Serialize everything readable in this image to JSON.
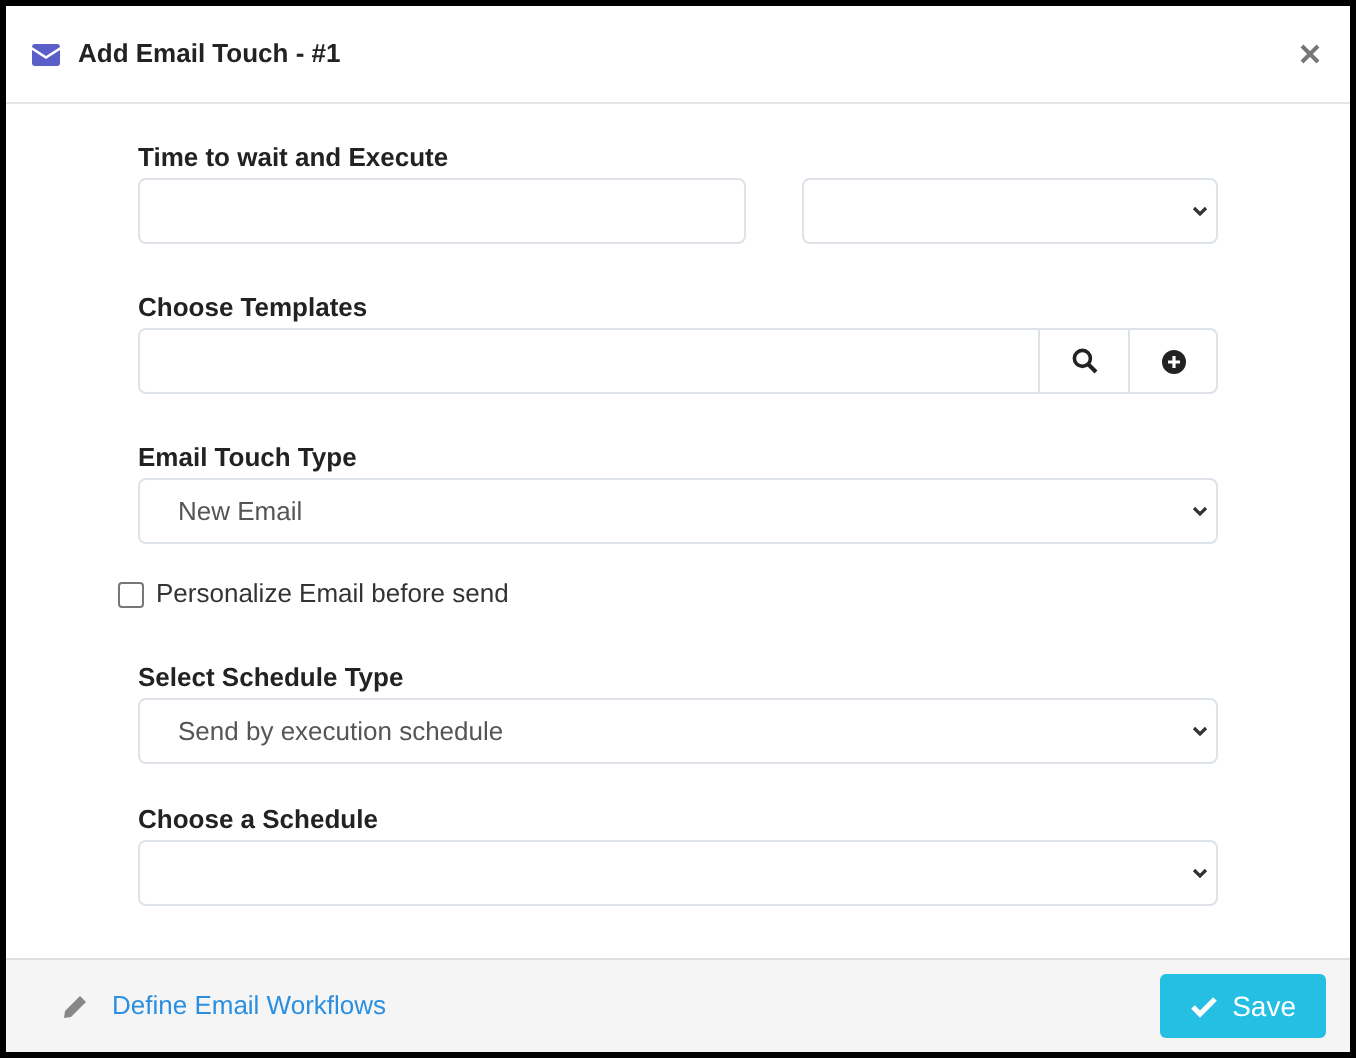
{
  "dialog": {
    "title": "Add Email Touch - #1"
  },
  "wait": {
    "label": "Time to wait and Execute"
  },
  "templates": {
    "label": "Choose Templates"
  },
  "touch_type": {
    "label": "Email Touch Type",
    "value": "New Email"
  },
  "personalize": {
    "label": "Personalize Email before send",
    "checked": false
  },
  "schedule_type": {
    "label": "Select Schedule Type",
    "value": "Send by execution schedule"
  },
  "schedule": {
    "label": "Choose a Schedule"
  },
  "footer": {
    "link": "Define Email Workflows",
    "save": "Save"
  }
}
